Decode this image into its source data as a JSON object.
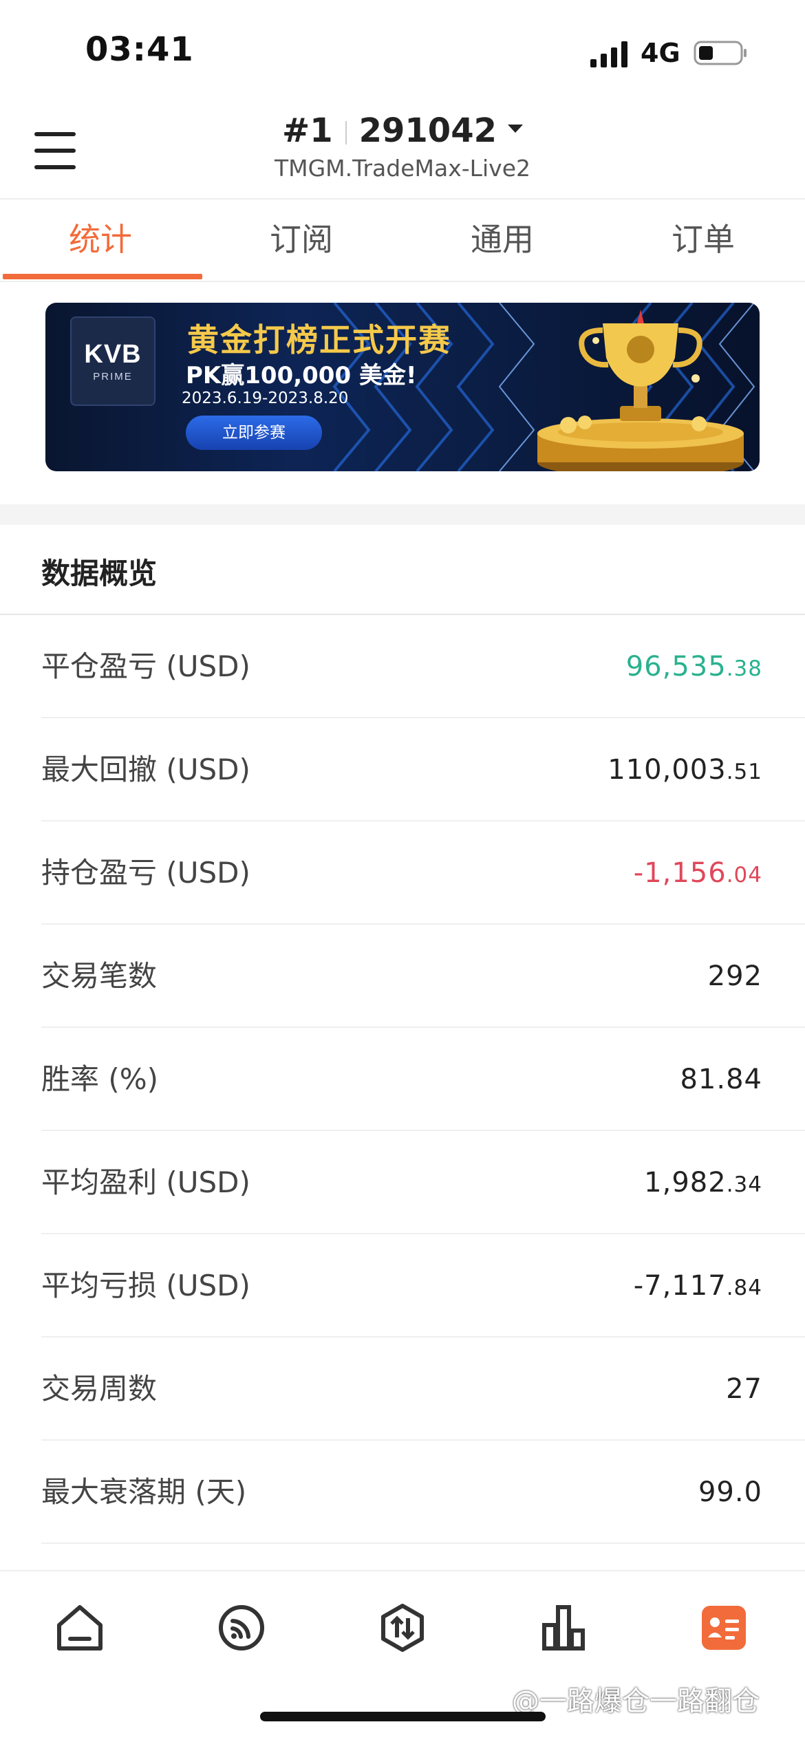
{
  "status_bar": {
    "time": "03:41",
    "network": "4G",
    "icons": [
      "signal-icon",
      "battery-icon"
    ]
  },
  "header": {
    "rank": "#1",
    "account_number": "291042",
    "server": "TMGM.TradeMax-Live2",
    "icons": [
      "menu-icon",
      "caret-down-icon"
    ]
  },
  "tabs": [
    {
      "label": "统计",
      "active": true
    },
    {
      "label": "订阅",
      "active": false
    },
    {
      "label": "通用",
      "active": false
    },
    {
      "label": "订单",
      "active": false
    }
  ],
  "banner": {
    "logo_main": "KVB",
    "logo_sub": "PRIME",
    "title": "黄金打榜正式开赛",
    "subtitle": "PK赢100,000 美金!",
    "date_range": "2023.6.19-2023.8.20",
    "cta_label": "立即参赛"
  },
  "overview": {
    "title": "数据概览",
    "rows": [
      {
        "label": "平仓盈亏 (USD)",
        "value_int": "96,535",
        "value_dec": ".38",
        "tone": "positive"
      },
      {
        "label": "最大回撤 (USD)",
        "value_int": "110,003",
        "value_dec": ".51",
        "tone": "neutral"
      },
      {
        "label": "持仓盈亏 (USD)",
        "value_int": "-1,156",
        "value_dec": ".04",
        "tone": "negative"
      },
      {
        "label": "交易笔数",
        "value_int": "292",
        "value_dec": "",
        "tone": "neutral"
      },
      {
        "label": "胜率 (%)",
        "value_int": "81.84",
        "value_dec": "",
        "tone": "neutral"
      },
      {
        "label": "平均盈利 (USD)",
        "value_int": "1,982",
        "value_dec": ".34",
        "tone": "neutral"
      },
      {
        "label": "平均亏损 (USD)",
        "value_int": "-7,117",
        "value_dec": ".84",
        "tone": "neutral"
      },
      {
        "label": "交易周数",
        "value_int": "27",
        "value_dec": "",
        "tone": "neutral"
      },
      {
        "label": "最大衰落期 (天)",
        "value_int": "99.0",
        "value_dec": "",
        "tone": "neutral"
      }
    ]
  },
  "bottom_nav": {
    "items": [
      "home-icon",
      "feed-icon",
      "trade-icon",
      "chart-icon",
      "profile-icon"
    ],
    "active_index": 4
  },
  "watermark": "@一路爆仓一路翻仓",
  "colors": {
    "accent": "#f26b3a",
    "positive": "#2ab18f",
    "negative": "#e0475a"
  }
}
